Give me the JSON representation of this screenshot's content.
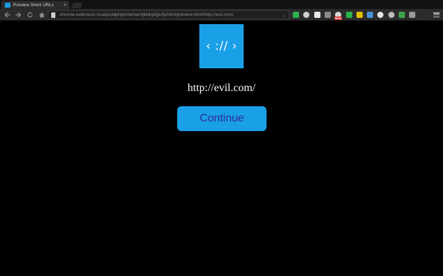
{
  "tab": {
    "title": "Preview Short URLs",
    "close_label": "×",
    "favicon": "extension-favicon-icon"
  },
  "toolbar": {
    "back_icon": "back-arrow-icon",
    "forward_icon": "forward-arrow-icon",
    "reload_icon": "reload-icon",
    "home_icon": "home-icon",
    "url": "chrome-extension://caejocldphpmnemamljkbkgkljpcfp/html/preview.html#http://evil.com/",
    "extensions": [
      {
        "name": "feedly-extension-icon",
        "color": "#2bb24c"
      },
      {
        "name": "circle-extension-icon",
        "color": "#cfcfcf"
      },
      {
        "name": "document-extension-icon",
        "color": "#e8e8e8"
      },
      {
        "name": "puzzle-extension-icon",
        "color": "#8a8a8a"
      },
      {
        "name": "gauge-extension-icon",
        "color": "#d9d9d9"
      },
      {
        "name": "evernote-extension-icon",
        "color": "#2bb24c"
      },
      {
        "name": "arrow-extension-icon",
        "color": "#e0c000"
      },
      {
        "name": "globe-extension-icon",
        "color": "#4a90d9"
      },
      {
        "name": "chat-extension-icon",
        "color": "#e6e6e6"
      },
      {
        "name": "moon-extension-icon",
        "color": "#bdbdbd"
      },
      {
        "name": "picture-extension-icon",
        "color": "#3fa34d"
      },
      {
        "name": "recycle-extension-icon",
        "color": "#9a9a9a"
      }
    ],
    "badge_text": "New"
  },
  "page": {
    "logo_text": "‹ :// ›",
    "url": "http://evil.com/",
    "continue_label": "Continue"
  },
  "colors": {
    "accent": "#1aa0e6",
    "button_text": "#2e2b94",
    "background": "#000000"
  }
}
